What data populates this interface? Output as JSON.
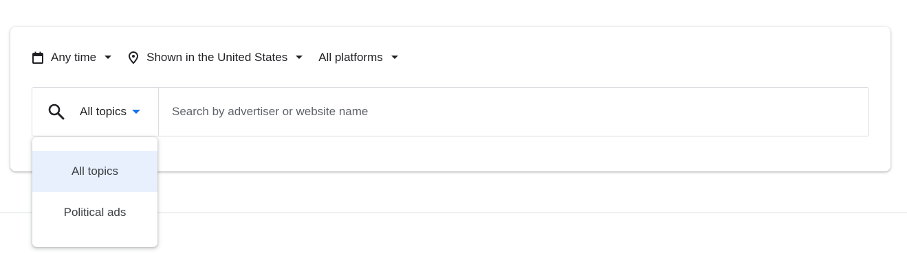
{
  "filters": {
    "time": {
      "label": "Any time",
      "icon": "calendar-icon"
    },
    "region": {
      "label": "Shown in the United States",
      "icon": "location-pin-icon"
    },
    "platform": {
      "label": "All platforms"
    }
  },
  "search": {
    "topic_label": "All topics",
    "placeholder": "Search by advertiser or website name",
    "value": ""
  },
  "topic_dropdown": {
    "options": [
      "All topics",
      "Political ads"
    ],
    "selected": "All topics"
  },
  "colors": {
    "accent": "#1a73e8",
    "selected_bg": "#e8f0fe",
    "border": "#dadce0",
    "text": "#202124"
  }
}
